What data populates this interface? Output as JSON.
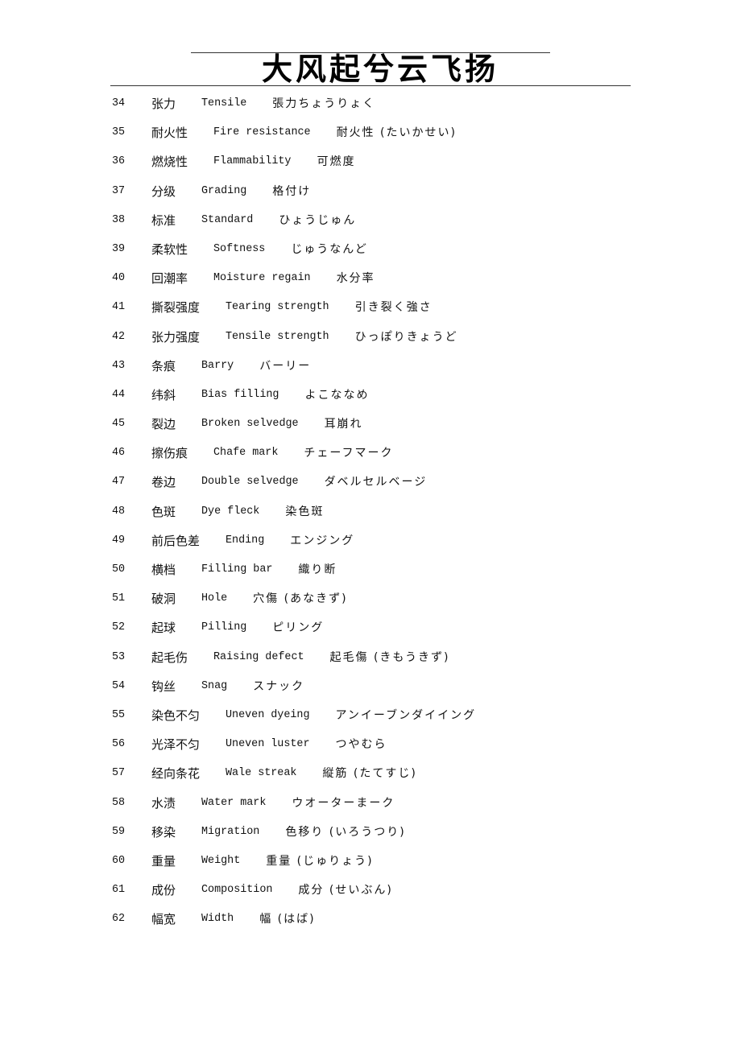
{
  "header": {
    "title": "大风起兮云飞扬"
  },
  "entries": [
    {
      "num": "34",
      "cn": "张力",
      "en": "Tensile",
      "jp": "張力ちょうりょく"
    },
    {
      "num": "35",
      "cn": "耐火性",
      "en": "Fire resistance",
      "jp": "耐火性 (たいかせい)"
    },
    {
      "num": "36",
      "cn": "燃烧性",
      "en": "Flammability",
      "jp": "可燃度"
    },
    {
      "num": "37",
      "cn": "分级",
      "en": "Grading",
      "jp": "格付け"
    },
    {
      "num": "38",
      "cn": "标准",
      "en": "Standard",
      "jp": "ひょうじゅん"
    },
    {
      "num": "39",
      "cn": "柔软性",
      "en": "Softness",
      "jp": "じゅうなんど"
    },
    {
      "num": "40",
      "cn": "回潮率",
      "en": "Moisture regain",
      "jp": "水分率"
    },
    {
      "num": "41",
      "cn": "撕裂强度",
      "en": "Tearing strength",
      "jp": "引き裂く強さ"
    },
    {
      "num": "42",
      "cn": "张力强度",
      "en": "Tensile strength",
      "jp": "ひっぽりきょうど"
    },
    {
      "num": "43",
      "cn": "条痕",
      "en": "Barry",
      "jp": "バーリー"
    },
    {
      "num": "44",
      "cn": "纬斜",
      "en": "Bias filling",
      "jp": "よこななめ"
    },
    {
      "num": "45",
      "cn": "裂边",
      "en": "Broken selvedge",
      "jp": "耳崩れ"
    },
    {
      "num": "46",
      "cn": "擦伤痕",
      "en": "Chafe mark",
      "jp": "チェーフマーク"
    },
    {
      "num": "47",
      "cn": "卷边",
      "en": "Double selvedge",
      "jp": "ダベルセルベージ"
    },
    {
      "num": "48",
      "cn": "色斑",
      "en": "Dye fleck",
      "jp": "染色斑"
    },
    {
      "num": "49",
      "cn": "前后色差",
      "en": "Ending",
      "jp": "エンジング"
    },
    {
      "num": "50",
      "cn": "横档",
      "en": "Filling bar",
      "jp": "織り断"
    },
    {
      "num": "51",
      "cn": "破洞",
      "en": "Hole",
      "jp": "穴傷 (あなきず)"
    },
    {
      "num": "52",
      "cn": "起球",
      "en": "Pilling",
      "jp": "ピリング"
    },
    {
      "num": "53",
      "cn": "起毛伤",
      "en": "Raising defect",
      "jp": "起毛傷 (きもうきず)"
    },
    {
      "num": "54",
      "cn": "钩丝",
      "en": "Snag",
      "jp": "スナック"
    },
    {
      "num": "55",
      "cn": "染色不匀",
      "en": "Uneven dyeing",
      "jp": "アンイーブンダイイング"
    },
    {
      "num": "56",
      "cn": "光泽不匀",
      "en": "Uneven luster",
      "jp": "つやむら"
    },
    {
      "num": "57",
      "cn": "经向条花",
      "en": "Wale streak",
      "jp": "縦筋 (たてすじ)"
    },
    {
      "num": "58",
      "cn": "水渍",
      "en": "Water mark",
      "jp": "ウオーターまーク"
    },
    {
      "num": "59",
      "cn": "移染",
      "en": "Migration",
      "jp": "色移り (いろうつり)"
    },
    {
      "num": "60",
      "cn": "重量",
      "en": "Weight",
      "jp": "重量 (じゅりょう)"
    },
    {
      "num": "61",
      "cn": "成份",
      "en": "Composition",
      "jp": "成分 (せいぶん)"
    },
    {
      "num": "62",
      "cn": "幅宽",
      "en": "Width",
      "jp": "幅 (はば)"
    }
  ]
}
